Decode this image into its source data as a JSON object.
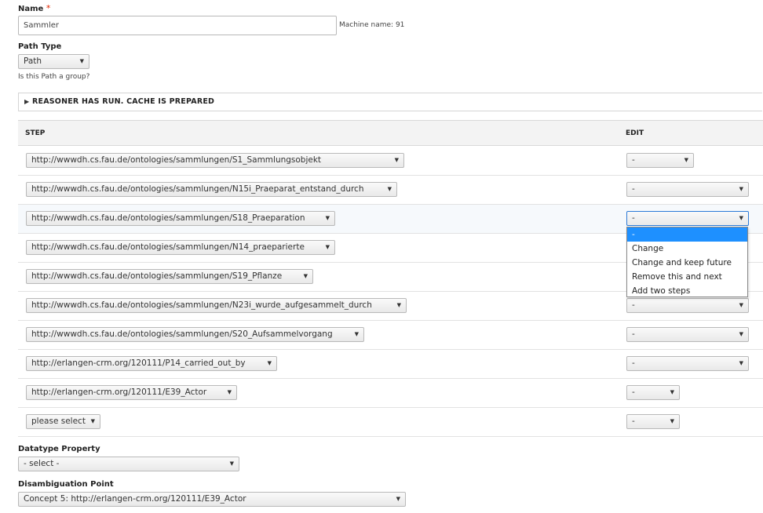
{
  "name_field": {
    "label": "Name",
    "required_mark": "*",
    "value": "Sammler",
    "machine_name": "Machine name: 91"
  },
  "path_type": {
    "label": "Path Type",
    "selected": "Path",
    "help": "Is this Path a group?"
  },
  "details": {
    "summary": "REASONER HAS RUN. CACHE IS PREPARED"
  },
  "table": {
    "headers": {
      "step": "STEP",
      "edit": "EDIT"
    },
    "rows": [
      {
        "step": "http://wwwdh.cs.fau.de/ontologies/sammlungen/S1_Sammlungsobjekt",
        "edit": "-"
      },
      {
        "step": "http://wwwdh.cs.fau.de/ontologies/sammlungen/N15i_Praeparat_entstand_durch",
        "edit": "-"
      },
      {
        "step": "http://wwwdh.cs.fau.de/ontologies/sammlungen/S18_Praeparation",
        "edit": "-"
      },
      {
        "step": "http://wwwdh.cs.fau.de/ontologies/sammlungen/N14_praeparierte",
        "edit": "-"
      },
      {
        "step": "http://wwwdh.cs.fau.de/ontologies/sammlungen/S19_Pflanze",
        "edit": "-"
      },
      {
        "step": "http://wwwdh.cs.fau.de/ontologies/sammlungen/N23i_wurde_aufgesammelt_durch",
        "edit": "-"
      },
      {
        "step": "http://wwwdh.cs.fau.de/ontologies/sammlungen/S20_Aufsammelvorgang",
        "edit": "-"
      },
      {
        "step": "http://erlangen-crm.org/120111/P14_carried_out_by",
        "edit": "-"
      },
      {
        "step": "http://erlangen-crm.org/120111/E39_Actor",
        "edit": "-"
      },
      {
        "step": "please select",
        "edit": "-"
      }
    ]
  },
  "edit_dropdown": {
    "options": [
      "-",
      "Change",
      "Change and keep future",
      "Remove this and next",
      "Add two steps"
    ]
  },
  "datatype_property": {
    "label": "Datatype Property",
    "selected": "- select -"
  },
  "disambiguation_point": {
    "label": "Disambiguation Point",
    "selected": "Concept 5: http://erlangen-crm.org/120111/E39_Actor"
  },
  "colors": {
    "accent": "#1e90ff",
    "required": "#e32700",
    "focus_border": "#2c7ad6"
  },
  "icons": {
    "dropdown": "dropdown-arrow-icon",
    "expand": "expand-triangle-icon"
  }
}
